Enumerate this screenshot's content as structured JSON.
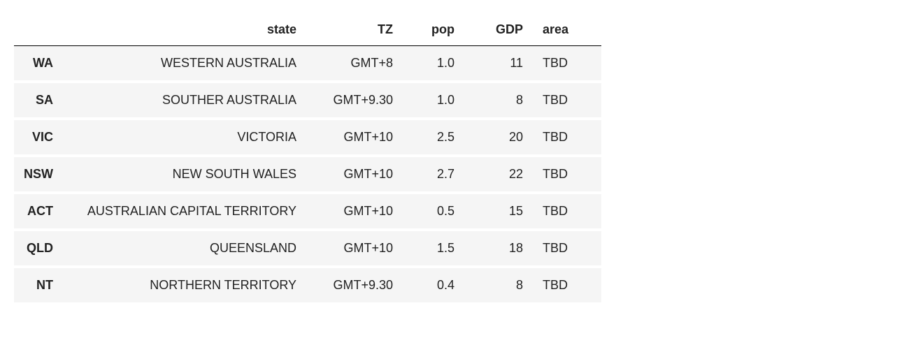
{
  "chart_data": {
    "type": "table",
    "columns": [
      "",
      "state",
      "TZ",
      "pop",
      "GDP",
      "area"
    ],
    "index": [
      "WA",
      "SA",
      "VIC",
      "NSW",
      "ACT",
      "QLD",
      "NT"
    ],
    "rows": [
      {
        "state": "WESTERN AUSTRALIA",
        "TZ": "GMT+8",
        "pop": 1.0,
        "GDP": 11,
        "area": "TBD"
      },
      {
        "state": "SOUTHER AUSTRALIA",
        "TZ": "GMT+9.30",
        "pop": 1.0,
        "GDP": 8,
        "area": "TBD"
      },
      {
        "state": "VICTORIA",
        "TZ": "GMT+10",
        "pop": 2.5,
        "GDP": 20,
        "area": "TBD"
      },
      {
        "state": "NEW SOUTH WALES",
        "TZ": "GMT+10",
        "pop": 2.7,
        "GDP": 22,
        "area": "TBD"
      },
      {
        "state": "AUSTRALIAN CAPITAL TERRITORY",
        "TZ": "GMT+10",
        "pop": 0.5,
        "GDP": 15,
        "area": "TBD"
      },
      {
        "state": "QUEENSLAND",
        "TZ": "GMT+10",
        "pop": 1.5,
        "GDP": 18,
        "area": "TBD"
      },
      {
        "state": "NORTHERN TERRITORY",
        "TZ": "GMT+9.30",
        "pop": 0.4,
        "GDP": 8,
        "area": "TBD"
      }
    ]
  },
  "display": {
    "header": {
      "blank": "",
      "state": "state",
      "tz": "TZ",
      "pop": "pop",
      "gdp": "GDP",
      "area": "area"
    },
    "rows": [
      {
        "idx": "WA",
        "state": "WESTERN AUSTRALIA",
        "tz": "GMT+8",
        "pop": "1.0",
        "gdp": "11",
        "area": "TBD"
      },
      {
        "idx": "SA",
        "state": "SOUTHER AUSTRALIA",
        "tz": "GMT+9.30",
        "pop": "1.0",
        "gdp": "8",
        "area": "TBD"
      },
      {
        "idx": "VIC",
        "state": "VICTORIA",
        "tz": "GMT+10",
        "pop": "2.5",
        "gdp": "20",
        "area": "TBD"
      },
      {
        "idx": "NSW",
        "state": "NEW SOUTH WALES",
        "tz": "GMT+10",
        "pop": "2.7",
        "gdp": "22",
        "area": "TBD"
      },
      {
        "idx": "ACT",
        "state": "AUSTRALIAN CAPITAL TERRITORY",
        "tz": "GMT+10",
        "pop": "0.5",
        "gdp": "15",
        "area": "TBD"
      },
      {
        "idx": "QLD",
        "state": "QUEENSLAND",
        "tz": "GMT+10",
        "pop": "1.5",
        "gdp": "18",
        "area": "TBD"
      },
      {
        "idx": "NT",
        "state": "NORTHERN TERRITORY",
        "tz": "GMT+9.30",
        "pop": "0.4",
        "gdp": "8",
        "area": "TBD"
      }
    ]
  }
}
